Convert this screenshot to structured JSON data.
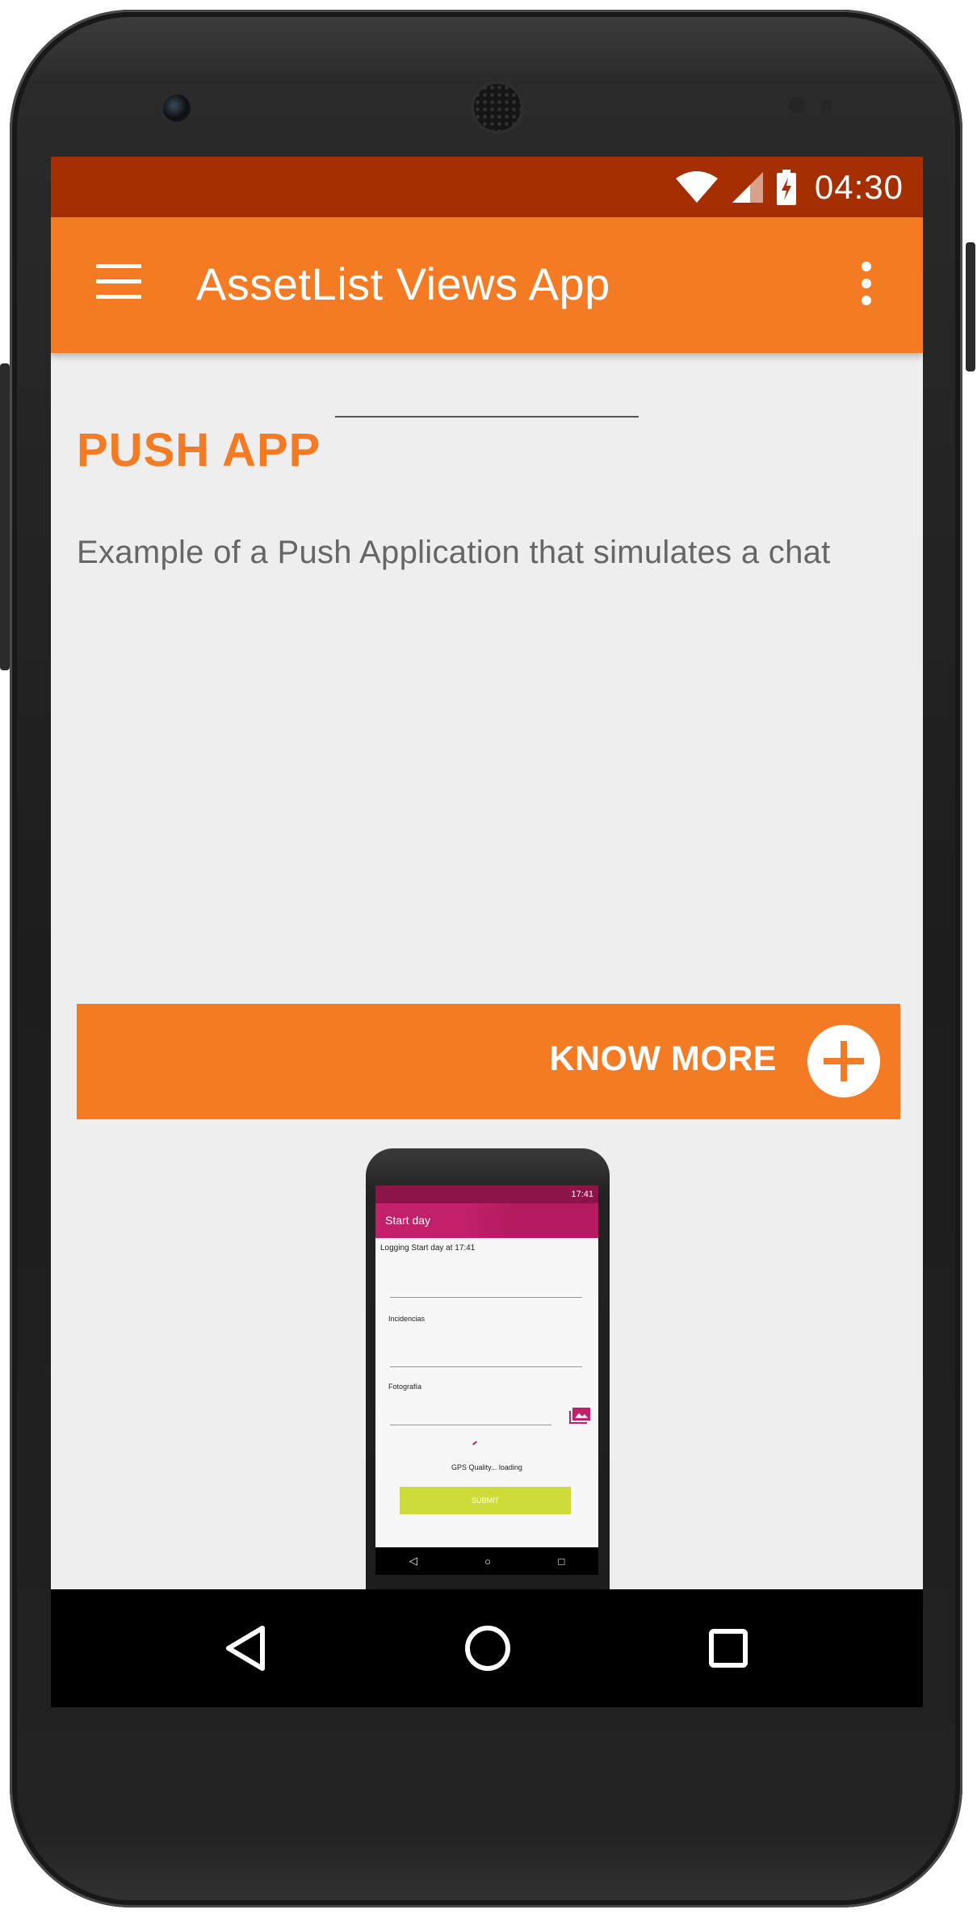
{
  "status_bar": {
    "time": "04:30",
    "icons": [
      "wifi-icon",
      "cell-signal-icon",
      "battery-charging-icon"
    ]
  },
  "app_bar": {
    "title": "AssetList Views App",
    "color": "#f47b23",
    "icons": [
      "menu-icon",
      "overflow-menu-icon"
    ]
  },
  "card": {
    "title": "PUSH APP",
    "description": "Example of a Push Application that simulates a chat",
    "button_label": "KNOW MORE",
    "button_icon": "plus-circle-icon"
  },
  "preview": {
    "status_time": "17:41",
    "title": "Start day",
    "logging_text": "Logging Start day at 17:41",
    "field_incidencias": "Incidencias",
    "field_fotografia": "Fotografía",
    "gps_text": "GPS Quality... loading",
    "submit_label": "SUBMIT",
    "accent_color": "#c2206a"
  },
  "nav_bar": {
    "icons": [
      "back-icon",
      "home-icon",
      "recents-icon"
    ]
  }
}
